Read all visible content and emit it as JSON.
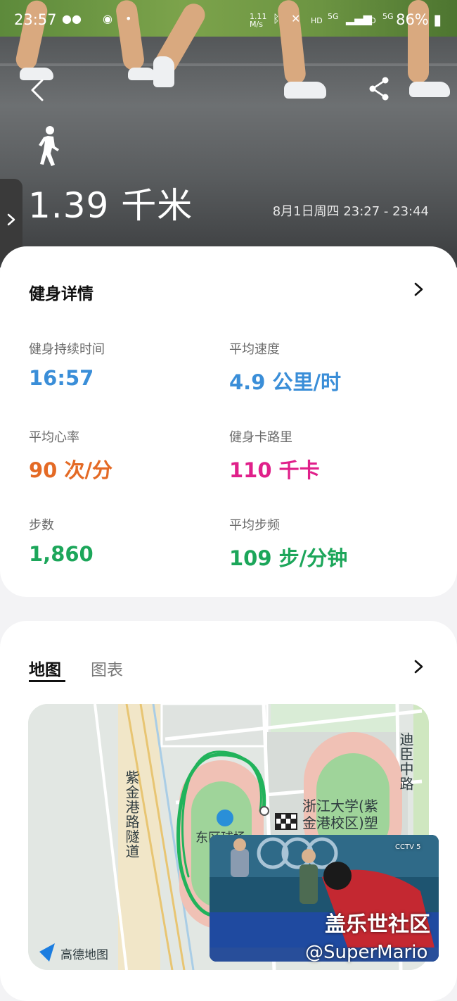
{
  "status_bar": {
    "time": "23:57",
    "speed": "1.11",
    "speed_unit": "M/s",
    "battery": "86%",
    "net_hd1": "HD",
    "net_5g1": "5G",
    "net_hd2": "HD",
    "net_5g2": "5G"
  },
  "hero": {
    "distance": "1.39 千米",
    "datetime": "8月1日周四 23:27 - 23:44"
  },
  "details": {
    "title": "健身详情",
    "stats": [
      {
        "label": "健身持续时间",
        "value": "16:57",
        "color": "#3a8ed8"
      },
      {
        "label": "平均速度",
        "value": "4.9 公里/时",
        "color": "#3a8ed8"
      },
      {
        "label": "平均心率",
        "value": "90 次/分",
        "color": "#e46a25"
      },
      {
        "label": "健身卡路里",
        "value": "110 千卡",
        "color": "#e0208a"
      },
      {
        "label": "步数",
        "value": "1,860",
        "color": "#1ca65a"
      },
      {
        "label": "平均步频",
        "value": "109 步/分钟",
        "color": "#1ca65a"
      }
    ]
  },
  "tabs": {
    "map": "地图",
    "chart": "图表"
  },
  "map": {
    "road_label": "紫金港路隧道",
    "road_label_right": "迪臣中路",
    "campus_label_1": "浙江大学(紫",
    "campus_label_2": "金港校区)塑",
    "field_label": "东区球场",
    "provider": "高德地图"
  },
  "overlay": {
    "tv_logo": "CCTV 5",
    "watermark_1": "盖乐世社区",
    "watermark_2": "@SuperMario"
  }
}
